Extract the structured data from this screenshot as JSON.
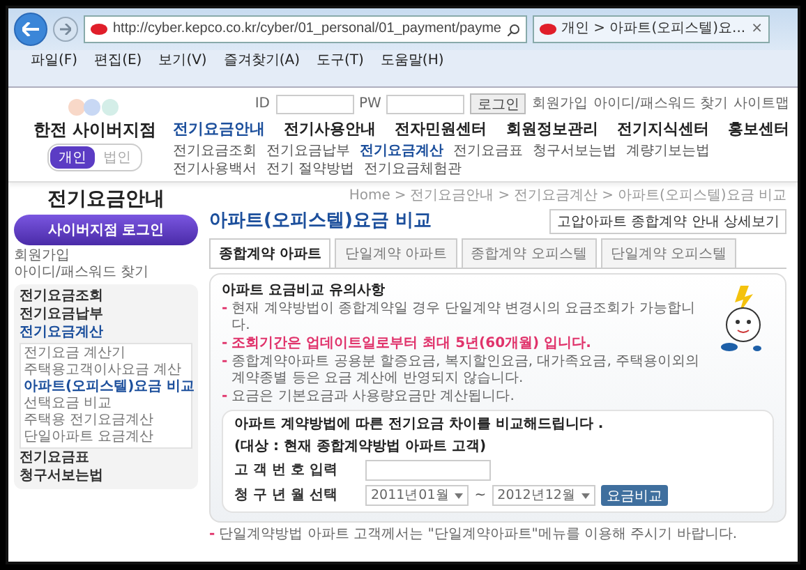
{
  "browser": {
    "url": "http://cyber.kepco.co.kr/cyber/01_personal/01_payment/payme",
    "tab_title": "개인 > 아파트(오피스텔)요...",
    "tab_close": "×",
    "menu": [
      "파일(F)",
      "편집(E)",
      "보기(V)",
      "즐겨찾기(A)",
      "도구(T)",
      "도움말(H)"
    ]
  },
  "header": {
    "logo": "한전 사이버지점",
    "user_types": [
      {
        "label": "개인",
        "selected": true
      },
      {
        "label": "법인",
        "selected": false
      }
    ],
    "id_label": "ID",
    "pw_label": "PW",
    "login_button": "로그인",
    "links": [
      "회원가입",
      "아이디/패스워드 찾기",
      "사이트맵"
    ],
    "nav": [
      {
        "label": "전기요금안내",
        "selected": true
      },
      {
        "label": "전기사용안내",
        "selected": false
      },
      {
        "label": "전자민원센터",
        "selected": false
      },
      {
        "label": "회원정보관리",
        "selected": false
      },
      {
        "label": "전기지식센터",
        "selected": false
      },
      {
        "label": "홍보센터",
        "selected": false
      }
    ],
    "subnav": [
      {
        "label": "전기요금조회",
        "selected": false
      },
      {
        "label": "전기요금납부",
        "selected": false
      },
      {
        "label": "전기요금계산",
        "selected": true
      },
      {
        "label": "전기요금표",
        "selected": false
      },
      {
        "label": "청구서보는법",
        "selected": false
      },
      {
        "label": "계량기보는법",
        "selected": false
      },
      {
        "label": "전기사용백서",
        "selected": false
      },
      {
        "label": "전기 절약방법",
        "selected": false
      },
      {
        "label": "전기요금체험관",
        "selected": false
      }
    ]
  },
  "sidebar": {
    "title": "전기요금안내",
    "login_button": "사이버지점 로그인",
    "links": [
      "회원가입",
      "아이디/패스워드 찾기"
    ],
    "items": [
      {
        "label": "전기요금조회",
        "selected": false
      },
      {
        "label": "전기요금납부",
        "selected": false
      },
      {
        "label": "전기요금계산",
        "selected": true,
        "children": [
          {
            "label": "전기요금 계산기",
            "selected": false
          },
          {
            "label": "주택용고객이사요금 계산",
            "selected": false
          },
          {
            "label": "아파트(오피스텔)요금 비교",
            "selected": true
          },
          {
            "label": "선택요금 비교",
            "selected": false
          },
          {
            "label": "주택용 전기요금계산",
            "selected": false
          },
          {
            "label": "단일아파트 요금계산",
            "selected": false
          }
        ]
      },
      {
        "label": "전기요금표",
        "selected": false
      },
      {
        "label": "청구서보는법",
        "selected": false
      }
    ]
  },
  "content": {
    "title": "아파트(오피스텔)요금 비교",
    "breadcrumb": [
      "Home",
      "전기요금안내",
      "전기요금계산",
      "아파트(오피스텔)요금 비교"
    ],
    "breadcrumb_separator": ">",
    "detail_button": "고압아파트 종합계약 안내 상세보기",
    "tabs": [
      {
        "label": "종합계약 아파트",
        "selected": true
      },
      {
        "label": "단일계약 아파트",
        "selected": false
      },
      {
        "label": "종합계약 오피스텔",
        "selected": false
      },
      {
        "label": "단일계약 오피스텔",
        "selected": false
      }
    ],
    "notice_title": "아파트 요금비교 유의사항",
    "bullet": "-",
    "notes": [
      {
        "kind": "normal",
        "text": "현재 계약방법이 종합계약일 경우 단일계약 변경시의 요금조회가 가능합니다."
      },
      {
        "kind": "warning",
        "text": "조회기간은 업데이트일로부터 최대 5년(60개월) 입니다."
      },
      {
        "kind": "normal",
        "text": "종합계약아파트 공용분 할증요금, 복지할인요금, 대가족요금, 주택용이외의 계약종별 등은 요금 계산에 반영되지 않습니다."
      },
      {
        "kind": "normal",
        "text": "요금은 기본요금과 사용량요금만 계산됩니다."
      }
    ],
    "form": {
      "heading": "아파트 계약방법에 따른 전기요금 차이를 비교해드립니다 .",
      "target": "(대상 : 현재 종합계약방법 아파트 고객)",
      "customer_label": "고 객 번 호 입력",
      "period_label": "청 구 년 월 선택",
      "start": "2011년01월",
      "range_separator": "~",
      "end": "2012년12월",
      "submit": "요금비교"
    },
    "footnote": "단일계약방법 아파트 고객께서는 \"단일계약아파트\"메뉴를 이용해 주시기 바랍니다."
  }
}
